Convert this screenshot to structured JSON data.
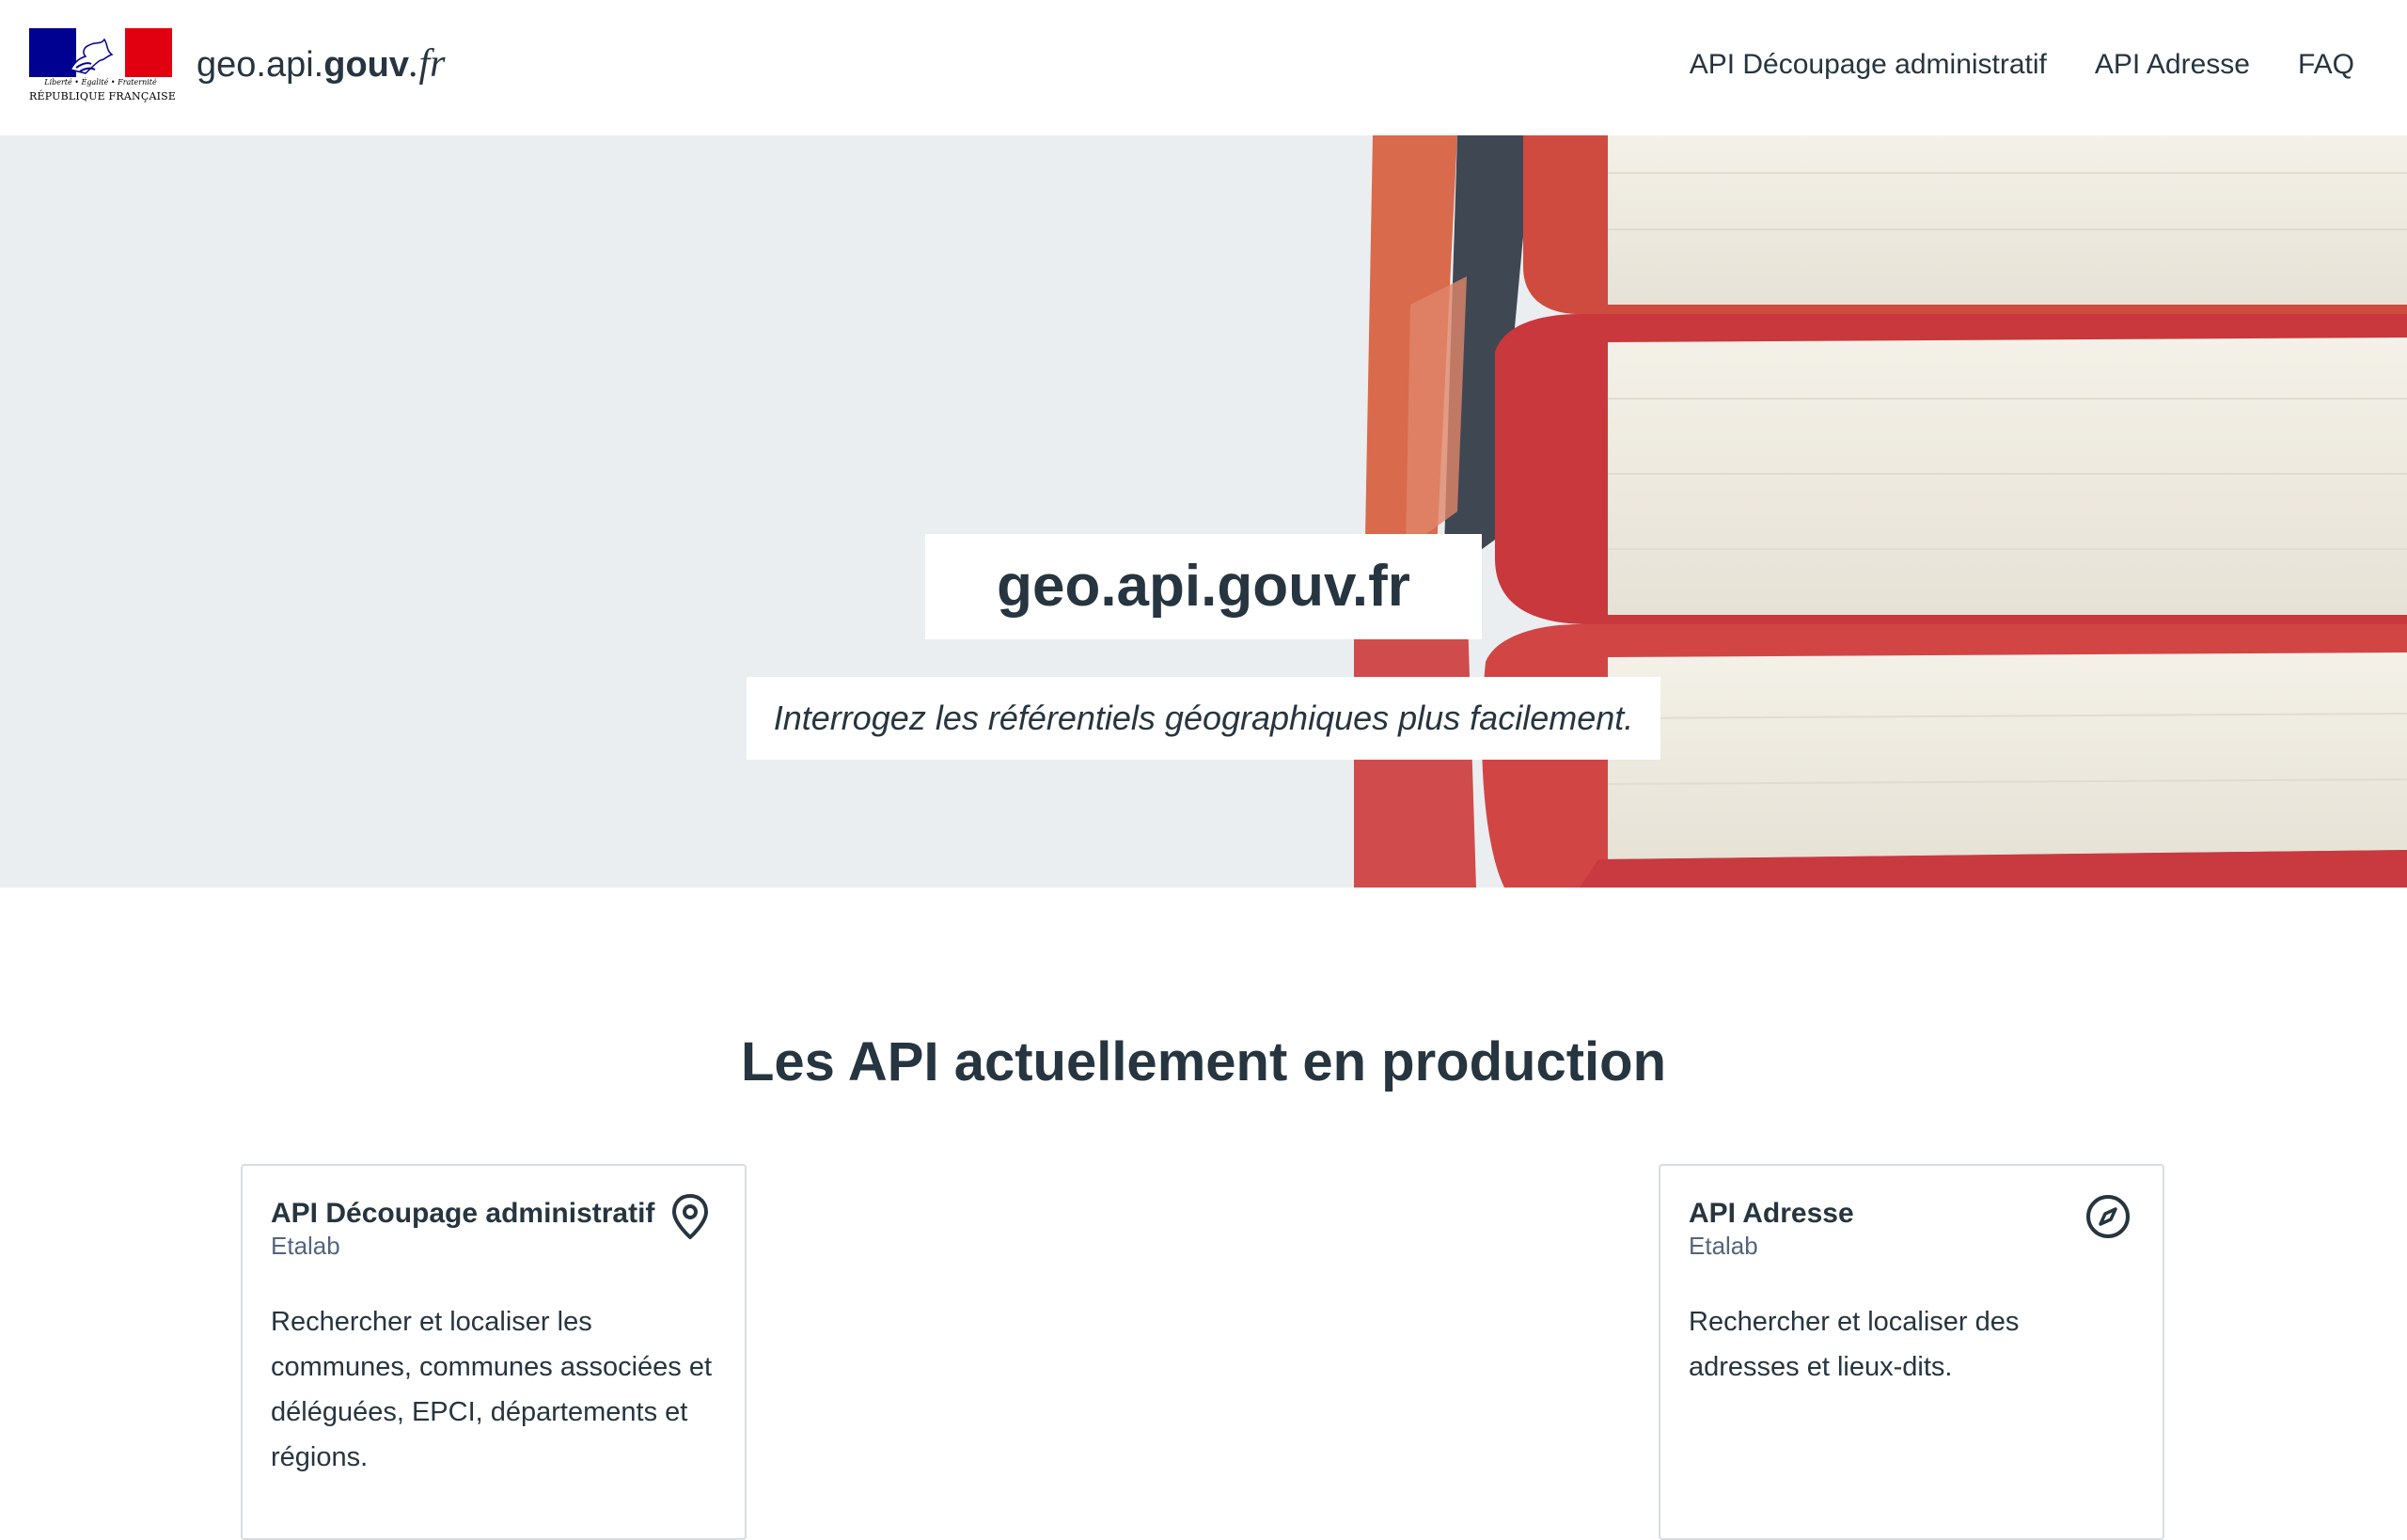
{
  "header": {
    "logo": {
      "motto": "Liberté • Égalité • Fraternité",
      "republic": "RÉPUBLIQUE FRANÇAISE"
    },
    "site_name": {
      "part1": "geo.api.",
      "part2": "gouv",
      "part3": ".fr"
    },
    "nav": [
      {
        "label": "API Découpage administratif"
      },
      {
        "label": "API Adresse"
      },
      {
        "label": "FAQ"
      }
    ]
  },
  "hero": {
    "title": "geo.api.gouv.fr",
    "tagline": "Interrogez les référentiels géographiques plus facilement."
  },
  "section": {
    "title": "Les API actuellement en production"
  },
  "cards": [
    {
      "title": "API Découpage administratif",
      "owner": "Etalab",
      "description": "Rechercher et localiser les communes, communes associées et déléguées, EPCI, départements et régions.",
      "icon": "map-pin-icon"
    },
    {
      "title": "API Adresse",
      "owner": "Etalab",
      "description": "Rechercher et localiser des adresses et lieux-dits.",
      "icon": "compass-icon"
    }
  ],
  "colors": {
    "text": "#26353f",
    "hero_bg": "#ebeef1",
    "flag_blue": "#000091",
    "flag_red": "#e1000f",
    "muted": "#53657d"
  }
}
